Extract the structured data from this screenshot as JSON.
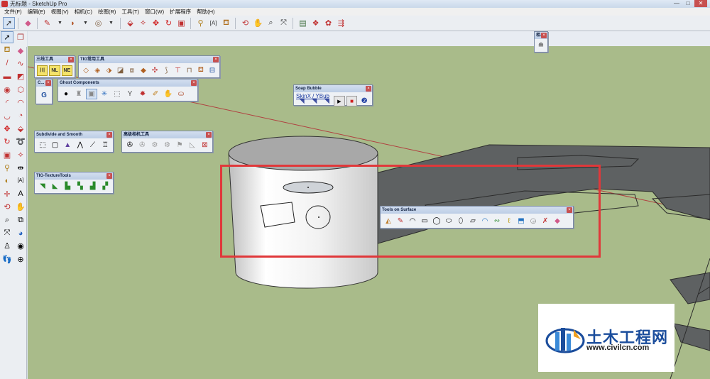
{
  "window": {
    "title": "无标题 - SketchUp Pro",
    "controls": [
      "—",
      "□",
      "✕"
    ]
  },
  "menu": [
    "文件(F)",
    "编辑(E)",
    "视图(V)",
    "相机(C)",
    "绘图(R)",
    "工具(T)",
    "窗口(W)",
    "扩展程序",
    "帮助(H)"
  ],
  "palettes": {
    "sanxian": {
      "title": "三线工具",
      "buttons": [
        "川",
        "NL",
        "NE"
      ]
    },
    "tig_common": {
      "title": "TIG常用工具"
    },
    "c_small": {
      "title": "C..."
    },
    "ghost": {
      "title": "Ghost Components"
    },
    "soap": {
      "title": "Soap Bubble",
      "link": "SkinX / YBub"
    },
    "subdivide": {
      "title": "Subdivide and Smooth"
    },
    "camera": {
      "title": "高级相机工具"
    },
    "texture": {
      "title": "TIG-TextureTools"
    },
    "tos": {
      "title": "Tools on Surface"
    },
    "camera_small": {
      "title": "相..."
    }
  },
  "watermark": {
    "name": "土木工程网",
    "url": "www.civilcn.com"
  },
  "colors": {
    "ground": "#a9bb8a",
    "sky": "#e8ecf2",
    "highlight": "#e0383a",
    "watermark_blue": "#1b4d9c"
  }
}
